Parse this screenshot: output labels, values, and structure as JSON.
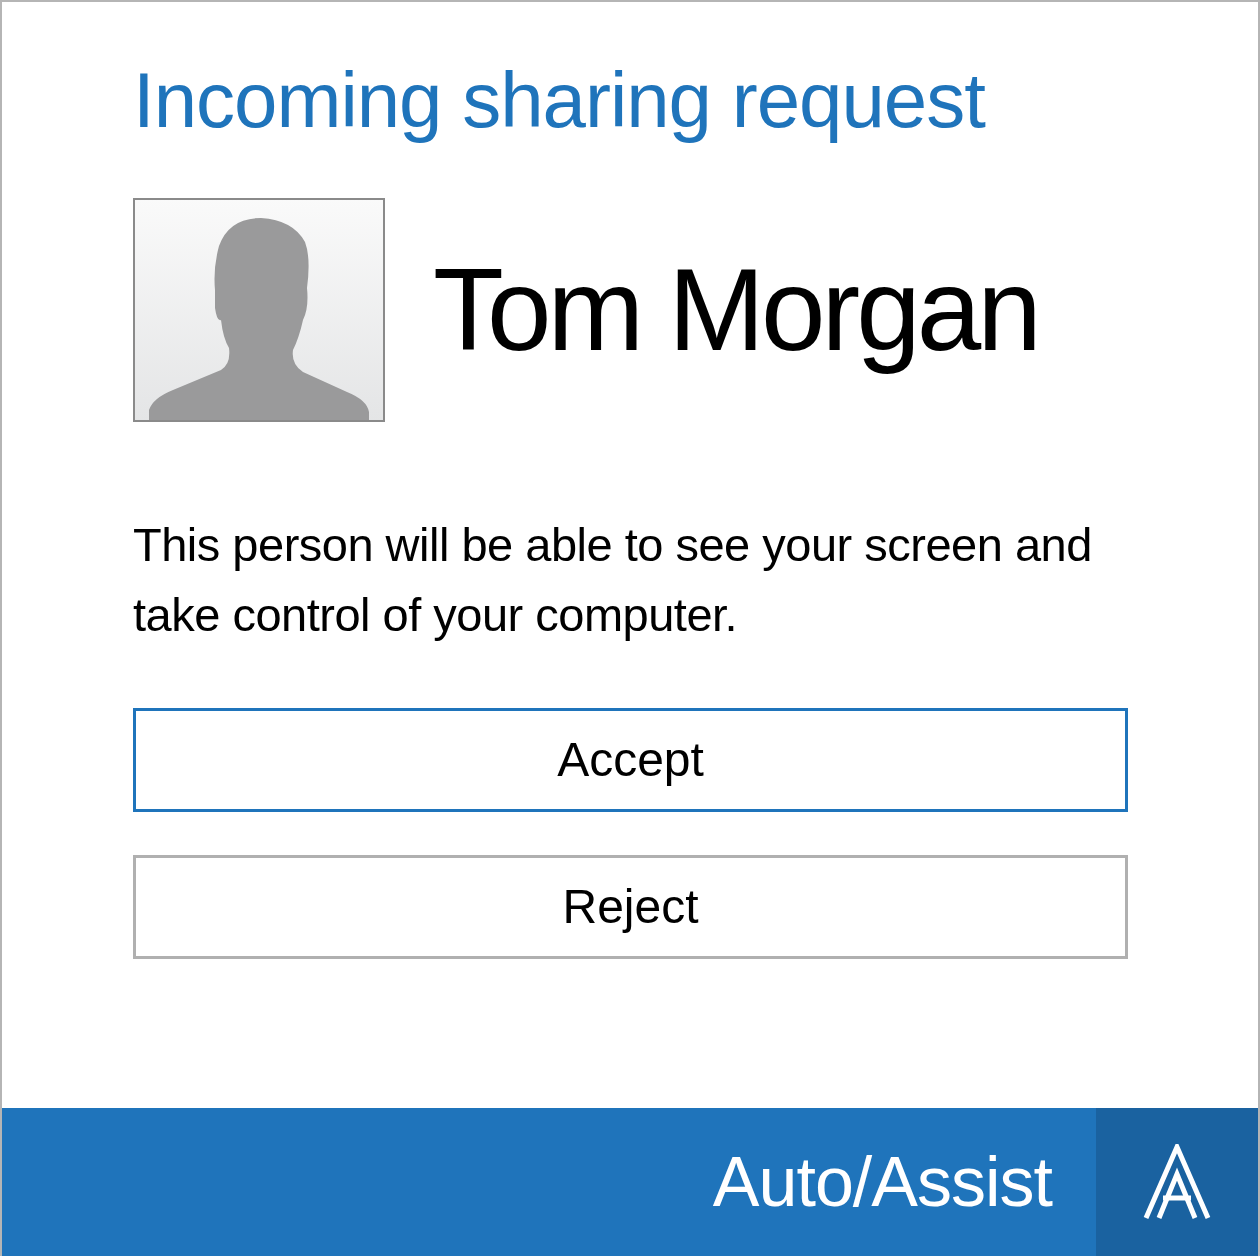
{
  "title": "Incoming sharing request",
  "contact": {
    "name": "Tom Morgan"
  },
  "message": "This person will be able to see your screen and take control of your computer.",
  "buttons": [
    {
      "label": "Accept",
      "focused": true
    },
    {
      "label": "Reject",
      "focused": false
    }
  ],
  "footer": {
    "brand": "Auto/Assist"
  }
}
